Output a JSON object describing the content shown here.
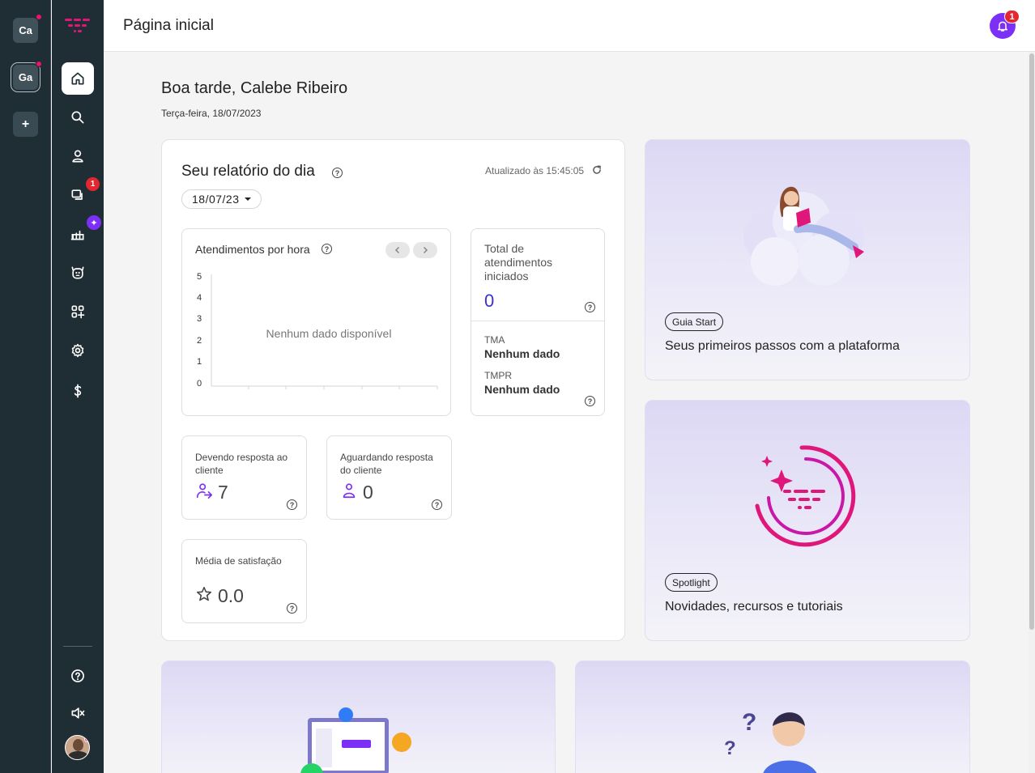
{
  "workspaces": [
    {
      "label": "Ca"
    },
    {
      "label": "Ga"
    },
    {
      "label": "+"
    }
  ],
  "nav": {
    "conversations_badge": "1"
  },
  "header": {
    "title": "Página inicial",
    "notification_count": "1"
  },
  "greeting": {
    "text": "Boa tarde, Calebe Ribeiro",
    "date": "Terça-feira, 18/07/2023"
  },
  "report": {
    "title": "Seu relatório do dia",
    "updated": "Atualizado às 15:45:05",
    "date_filter": "18/07/23",
    "chart": {
      "title": "Atendimentos por hora",
      "empty": "Nenhum dado disponível",
      "y_ticks": [
        "5",
        "4",
        "3",
        "2",
        "1",
        "0"
      ]
    },
    "total": {
      "label": "Total de atendimentos iniciados",
      "value": "0",
      "tma_label": "TMA",
      "tma_value": "Nenhum dado",
      "tmpr_label": "TMPR",
      "tmpr_value": "Nenhum dado"
    },
    "kpis": {
      "owing": {
        "label": "Devendo resposta ao cliente",
        "value": "7"
      },
      "waiting": {
        "label": "Aguardando resposta do cliente",
        "value": "0"
      },
      "satisfaction": {
        "label": "Média de satisfação",
        "value": "0.0"
      }
    }
  },
  "promos": {
    "start": {
      "tag": "Guia Start",
      "title": "Seus primeiros passos com a plataforma"
    },
    "spotlight": {
      "tag": "Spotlight",
      "title": "Novidades, recursos e tutoriais"
    }
  },
  "colors": {
    "sidebar": "#1f2d35",
    "accent": "#7b2ff7",
    "brand_pink": "#e0177a",
    "value_blue": "#3b2fd6"
  }
}
